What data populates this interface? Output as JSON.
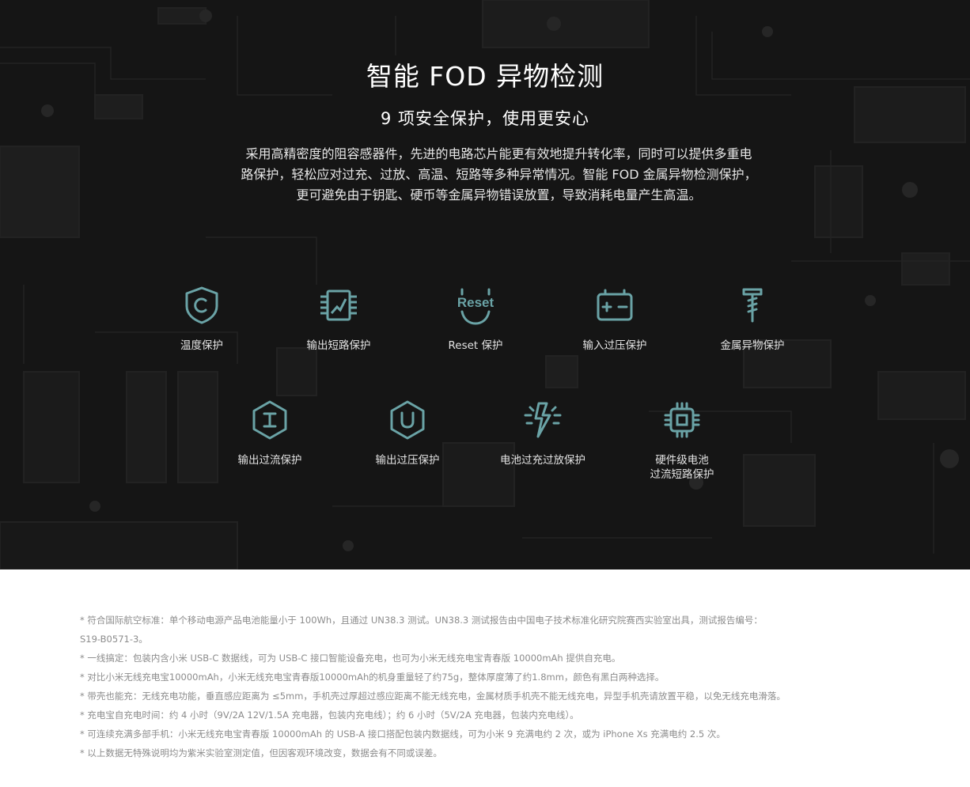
{
  "hero": {
    "title": "智能 FOD 异物检测",
    "subtitle": "9 项安全保护，使用更安心",
    "description": "采用高精密度的阻容感器件，先进的电路芯片能更有效地提升转化率，同时可以提供多重电路保护，轻松应对过充、过放、高温、短路等多种异常情况。智能 FOD 金属异物检测保护，更可避免由于钥匙、硬币等金属异物错误放置，导致消耗电量产生高温。"
  },
  "colors": {
    "background": "#151515",
    "icon_teal": "#6aa3a6",
    "title_text": "#ffffff",
    "note_text": "#8c8c8c"
  },
  "features": [
    {
      "label": "温度保护",
      "icon": "shield-c-icon"
    },
    {
      "label": "输出短路保护",
      "icon": "circuit-board-icon"
    },
    {
      "label": "Reset 保护",
      "icon": "reset-icon"
    },
    {
      "label": "输入过压保护",
      "icon": "battery-plus-minus-icon"
    },
    {
      "label": "金属异物保护",
      "icon": "screw-icon"
    },
    {
      "label": "输出过流保护",
      "icon": "hexagon-i-icon"
    },
    {
      "label": "输出过压保护",
      "icon": "hexagon-u-icon"
    },
    {
      "label": "电池过充过放保护",
      "icon": "lightning-icon"
    },
    {
      "label": "硬件级电池\n过流短路保护",
      "icon": "chip-icon"
    }
  ],
  "notes": [
    "*  符合国际航空标准：单个移动电源产品电池能量小于 100Wh，且通过 UN38.3 测试。UN38.3 测试报告由中国电子技术标准化研究院赛西实验室出具，测试报告编号：",
    "S19-B0571-3。",
    "*  一线搞定：包装内含小米 USB-C 数据线，可为 USB-C 接口智能设备充电，也可为小米无线充电宝青春版 10000mAh 提供自充电。",
    "*  对比小米无线充电宝10000mAh，小米无线充电宝青春版10000mAh的机身重量轻了约75g，整体厚度薄了约1.8mm，颜色有黑白两种选择。",
    "* 带壳也能充：无线充电功能，垂直感应距离为 ≤5mm，手机壳过厚超过感应距离不能无线充电，金属材质手机壳不能无线充电，异型手机壳请放置平稳，以免无线充电滑落。",
    "*  充电宝自充电时间：约 4 小时（9V/2A 12V/1.5A 充电器，包装内充电线）；约 6 小时（5V/2A 充电器，包装内充电线）。",
    "*  可连续充满多部手机：小米无线充电宝青春版 10000mAh 的 USB-A 接口搭配包装内数据线，可为小米 9 充满电约 2 次，或为 iPhone Xs 充满电约 2.5 次。",
    "*  以上数据无特殊说明均为紫米实验室测定值，但因客观环境改变，数据会有不同或误差。"
  ]
}
